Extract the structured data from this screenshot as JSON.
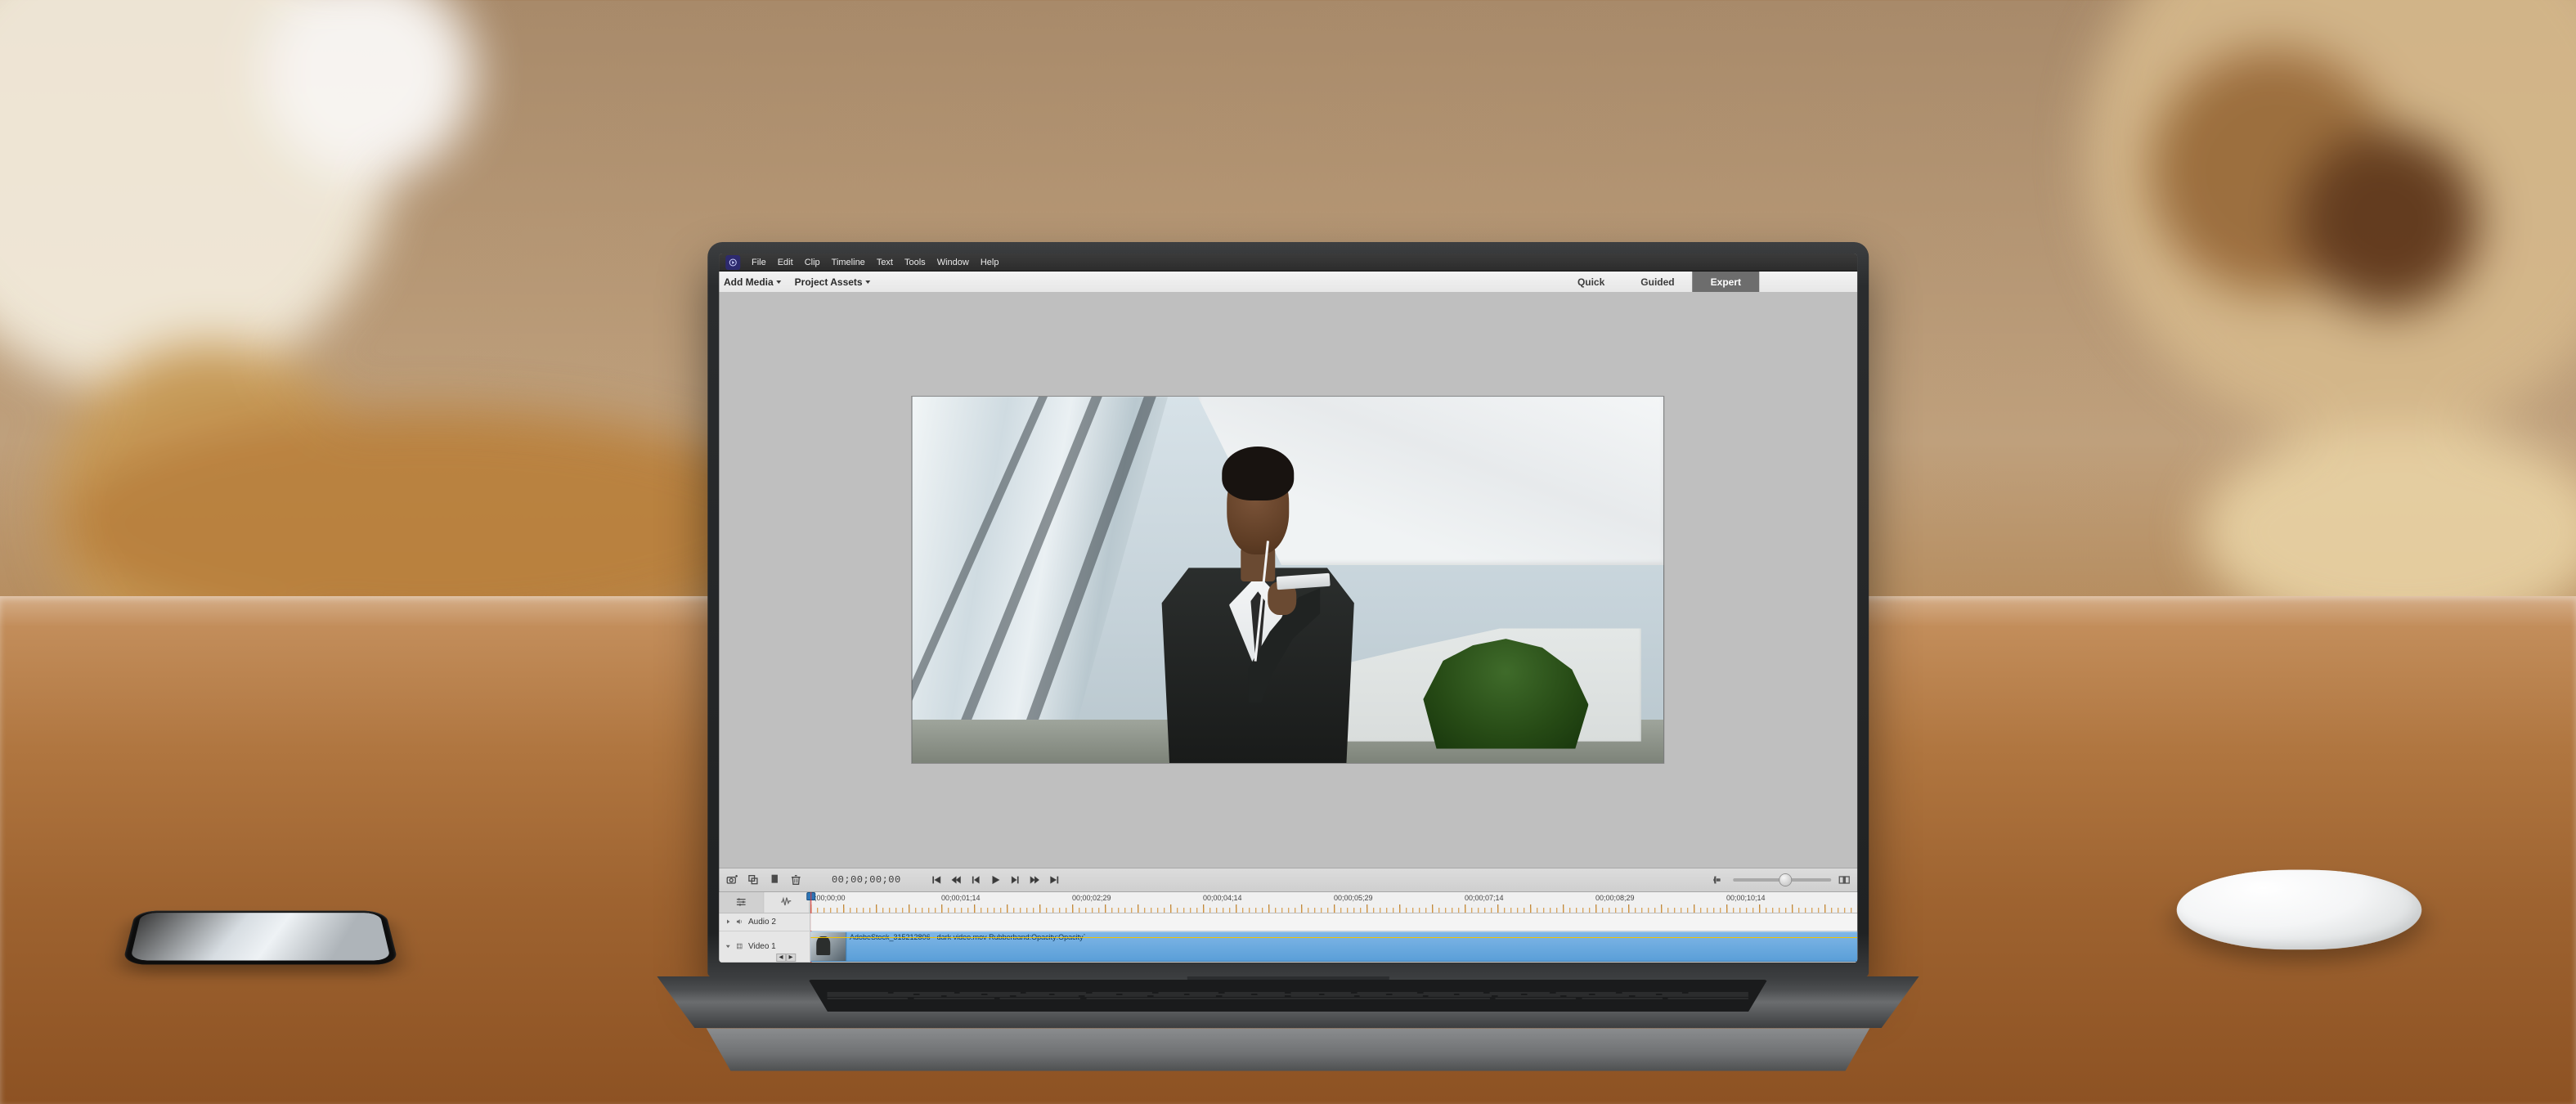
{
  "menubar": {
    "items": [
      "File",
      "Edit",
      "Clip",
      "Timeline",
      "Text",
      "Tools",
      "Window",
      "Help"
    ]
  },
  "toolbar": {
    "add_media": "Add Media",
    "project_assets": "Project Assets"
  },
  "modes": {
    "quick": "Quick",
    "guided": "Guided",
    "expert": "Expert",
    "active": "expert"
  },
  "transport": {
    "timecode": "00;00;00;00",
    "icons": {
      "camera": "camera-plus-icon",
      "duplicate": "duplicate-icon",
      "marker": "marker-icon",
      "delete": "trash-icon",
      "goto_start": "goto-start-icon",
      "rewind": "rewind-icon",
      "step_back": "step-back-icon",
      "play": "play-icon",
      "step_fwd": "step-forward-icon",
      "fast_fwd": "fast-forward-icon",
      "goto_end": "goto-end-icon",
      "zoom_out": "zoom-out-icon",
      "zoom_in": "zoom-in-icon",
      "zoom_fit": "zoom-fit-icon"
    }
  },
  "ruler": {
    "labels": [
      "0;00;00;00",
      "00;00;01;14",
      "00;00;02;29",
      "00;00;04;14",
      "00;00;05;29",
      "00;00;07;14",
      "00;00;08;29",
      "00;00;10;14"
    ]
  },
  "tracks": {
    "audio2": {
      "name": "Audio 2"
    },
    "video1": {
      "name": "Video 1"
    }
  },
  "clip": {
    "label": "AdobeStock_315212806 - dark video.mov Rubberband:Opacity:Opacity`"
  },
  "timeline_tabs": {
    "video_icon": "sliders-icon",
    "audio_icon": "waveform-icon"
  }
}
